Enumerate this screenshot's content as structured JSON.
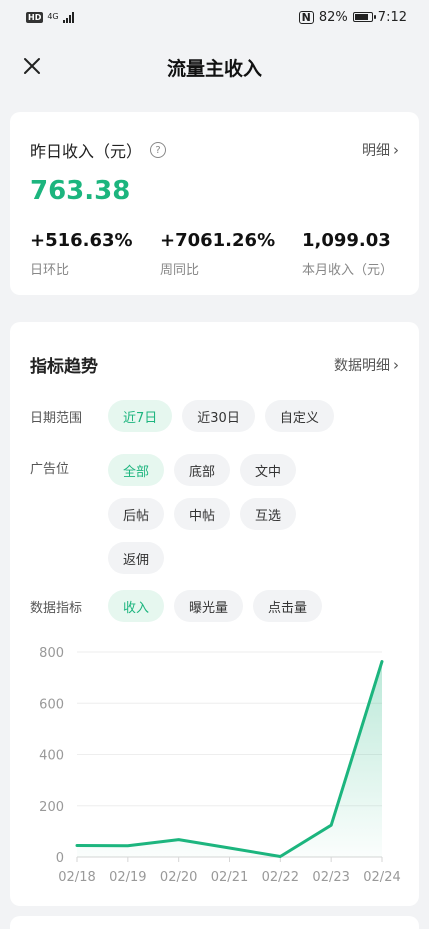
{
  "status_bar": {
    "hd": "HD",
    "net": "4G",
    "nfc": "N",
    "battery_pct": "82%",
    "battery_level": 0.82,
    "time": "7:12"
  },
  "nav": {
    "title": "流量主收入",
    "close_icon": "close-icon"
  },
  "summary": {
    "title": "昨日收入（元）",
    "help_icon": "question-circle-icon",
    "detail_link": "明细",
    "income": "763.38",
    "accent_color": "#1cb57e",
    "stats": [
      {
        "value": "+516.63%",
        "label": "日环比"
      },
      {
        "value": "+7061.26%",
        "label": "周同比"
      },
      {
        "value": "1,099.03",
        "label": "本月收入（元）"
      }
    ]
  },
  "trend": {
    "title": "指标趋势",
    "detail_link": "数据明细",
    "date_range": {
      "label": "日期范围",
      "options": [
        "近7日",
        "近30日",
        "自定义"
      ],
      "selected": "近7日"
    },
    "ad_slot": {
      "label": "广告位",
      "options": [
        "全部",
        "底部",
        "文中",
        "后帖",
        "中帖",
        "互选",
        "返佣"
      ],
      "selected": "全部"
    },
    "metric": {
      "label": "数据指标",
      "options": [
        "收入",
        "曝光量",
        "点击量"
      ],
      "selected": "收入"
    }
  },
  "chart_data": {
    "type": "area",
    "categories": [
      "02/18",
      "02/19",
      "02/20",
      "02/21",
      "02/22",
      "02/23",
      "02/24"
    ],
    "series": [
      {
        "values": [
          45,
          44,
          68,
          35,
          2,
          124,
          763
        ]
      }
    ],
    "ylim": [
      0,
      800
    ],
    "yticks": [
      0,
      200,
      400,
      600,
      800
    ],
    "grid": true,
    "line_color": "#1cb57e"
  }
}
